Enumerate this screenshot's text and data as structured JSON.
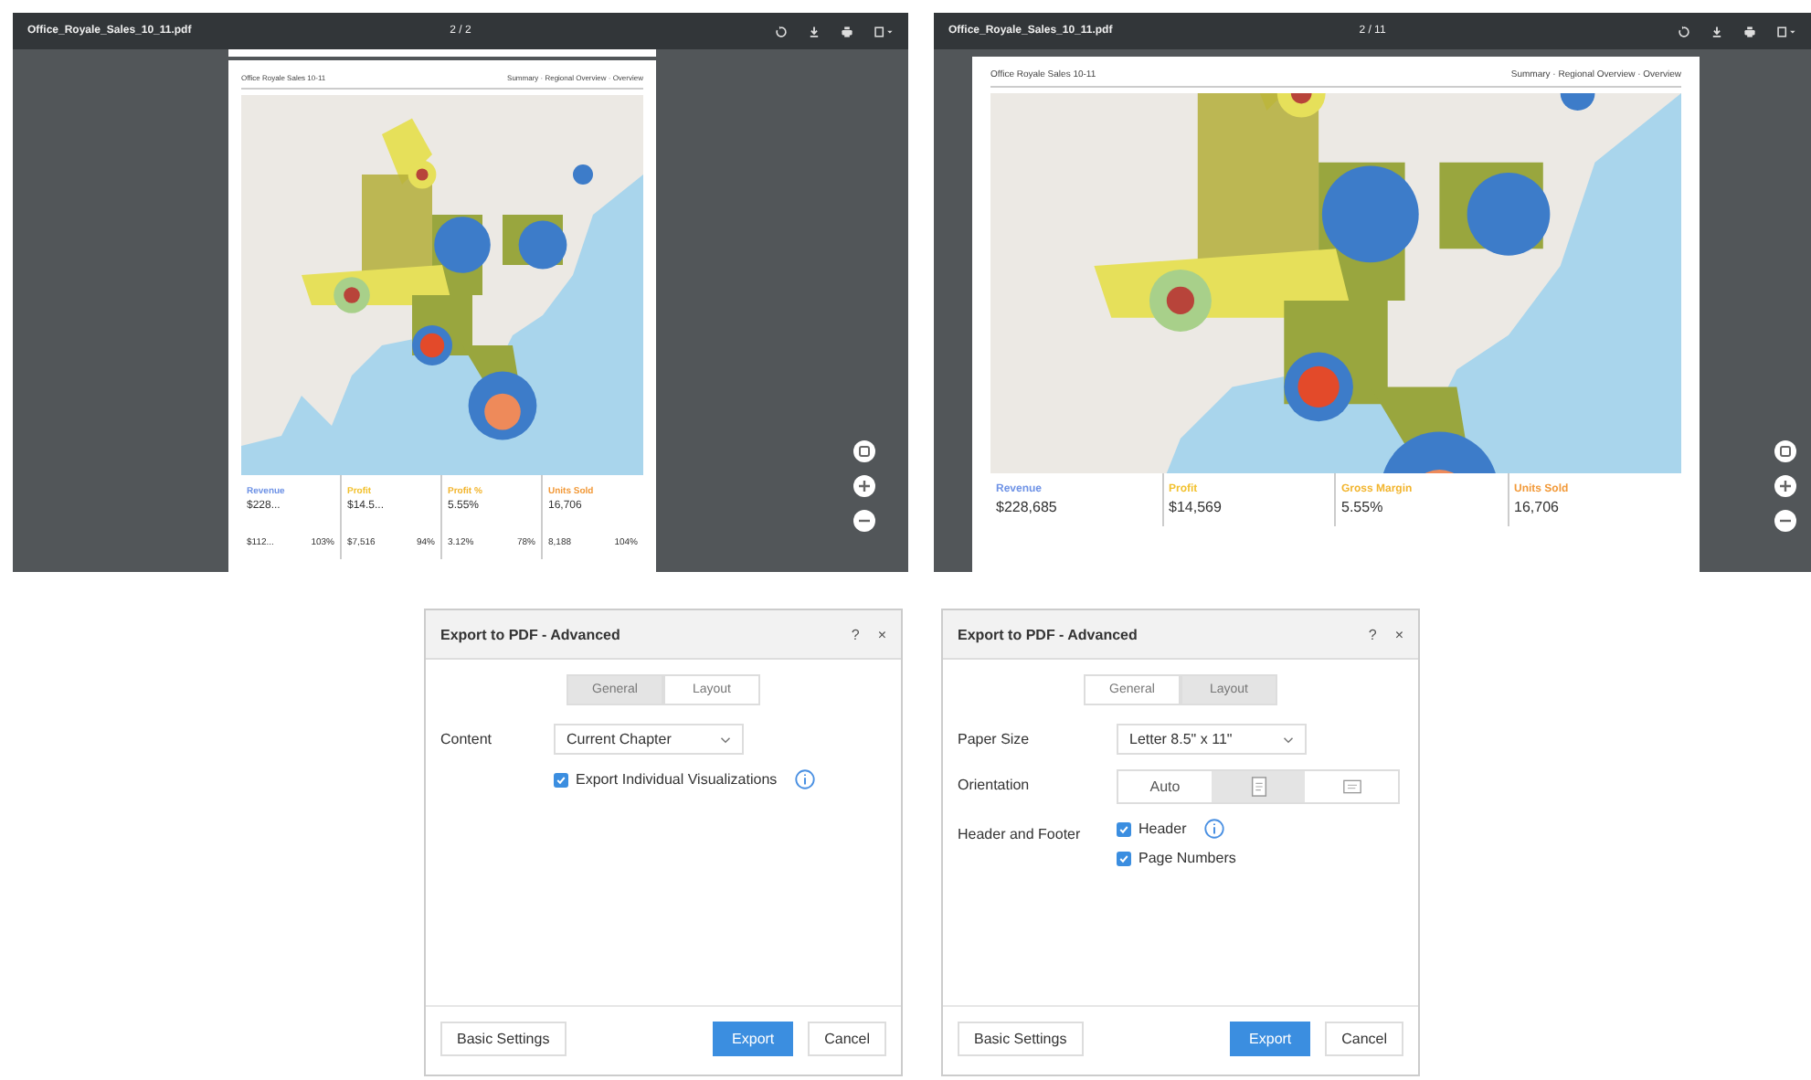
{
  "viewers": [
    {
      "file_name": "Office_Royale_Sales_10_11.pdf",
      "page_indicator": "2 / 2",
      "report_title": "Office Royale Sales 10-11",
      "breadcrumb": "Summary · Regional Overview · Overview",
      "kpis": [
        {
          "label": "Revenue",
          "color": "#6f93e6",
          "value": "$228...",
          "subs": [
            "$112...",
            "103%"
          ]
        },
        {
          "label": "Profit",
          "color": "#f2c12e",
          "value": "$14.5...",
          "subs": [
            "$7,516",
            "94%"
          ]
        },
        {
          "label": "Profit %",
          "color": "#f2b52e",
          "value": "5.55%",
          "subs": [
            "3.12%",
            "78%"
          ]
        },
        {
          "label": "Units Sold",
          "color": "#f29a3a",
          "value": "16,706",
          "subs": [
            "8,188",
            "104%"
          ]
        }
      ]
    },
    {
      "file_name": "Office_Royale_Sales_10_11.pdf",
      "page_indicator": "2 / 11",
      "report_title": "Office Royale Sales 10-11",
      "breadcrumb": "Summary · Regional Overview · Overview",
      "kpis": [
        {
          "label": "Revenue",
          "color": "#6f93e6",
          "value": "$228,685"
        },
        {
          "label": "Profit",
          "color": "#f2c12e",
          "value": "$14,569"
        },
        {
          "label": "Gross Margin",
          "color": "#f2b52e",
          "value": "5.55%"
        },
        {
          "label": "Units Sold",
          "color": "#f29a3a",
          "value": "16,706"
        }
      ]
    }
  ],
  "dialogs": [
    {
      "title": "Export to PDF - Advanced",
      "help": "?",
      "close": "×",
      "tabs": [
        {
          "label": "General",
          "selected": true
        },
        {
          "label": "Layout",
          "selected": false
        }
      ],
      "rows": [
        {
          "label": "Content",
          "controls": [
            {
              "kind": "select",
              "value": "Current Chapter"
            }
          ]
        },
        {
          "controls": [
            {
              "kind": "checkbox",
              "text": "Export Individual Visualizations",
              "checked": true,
              "info": true
            }
          ]
        }
      ],
      "buttons": [
        {
          "label": "Basic Settings",
          "kind": "secondary"
        },
        {
          "label": "Export",
          "kind": "primary"
        },
        {
          "label": "Cancel",
          "kind": "secondary"
        }
      ]
    },
    {
      "title": "Export to PDF - Advanced",
      "help": "?",
      "close": "×",
      "tabs": [
        {
          "label": "General",
          "selected": false
        },
        {
          "label": "Layout",
          "selected": true
        }
      ],
      "rows": [
        {
          "label": "Paper Size",
          "controls": [
            {
              "kind": "select",
              "value": "Letter 8.5\" x 11\""
            }
          ]
        },
        {
          "label": "Orientation",
          "controls": [
            {
              "kind": "segmented",
              "options": [
                {
                  "kind": "text",
                  "text": "Auto",
                  "selected": false
                },
                {
                  "kind": "portrait",
                  "selected": true
                },
                {
                  "kind": "landscape",
                  "selected": false
                }
              ]
            }
          ]
        },
        {
          "label": "Header and Footer",
          "controls": [
            {
              "kind": "checkbox",
              "text": "Header",
              "checked": true,
              "info": true
            },
            {
              "kind": "checkbox",
              "text": "Page Numbers",
              "checked": true
            }
          ]
        }
      ],
      "buttons": [
        {
          "label": "Basic Settings",
          "kind": "secondary"
        },
        {
          "label": "Export",
          "kind": "primary"
        },
        {
          "label": "Cancel",
          "kind": "secondary"
        }
      ]
    }
  ]
}
